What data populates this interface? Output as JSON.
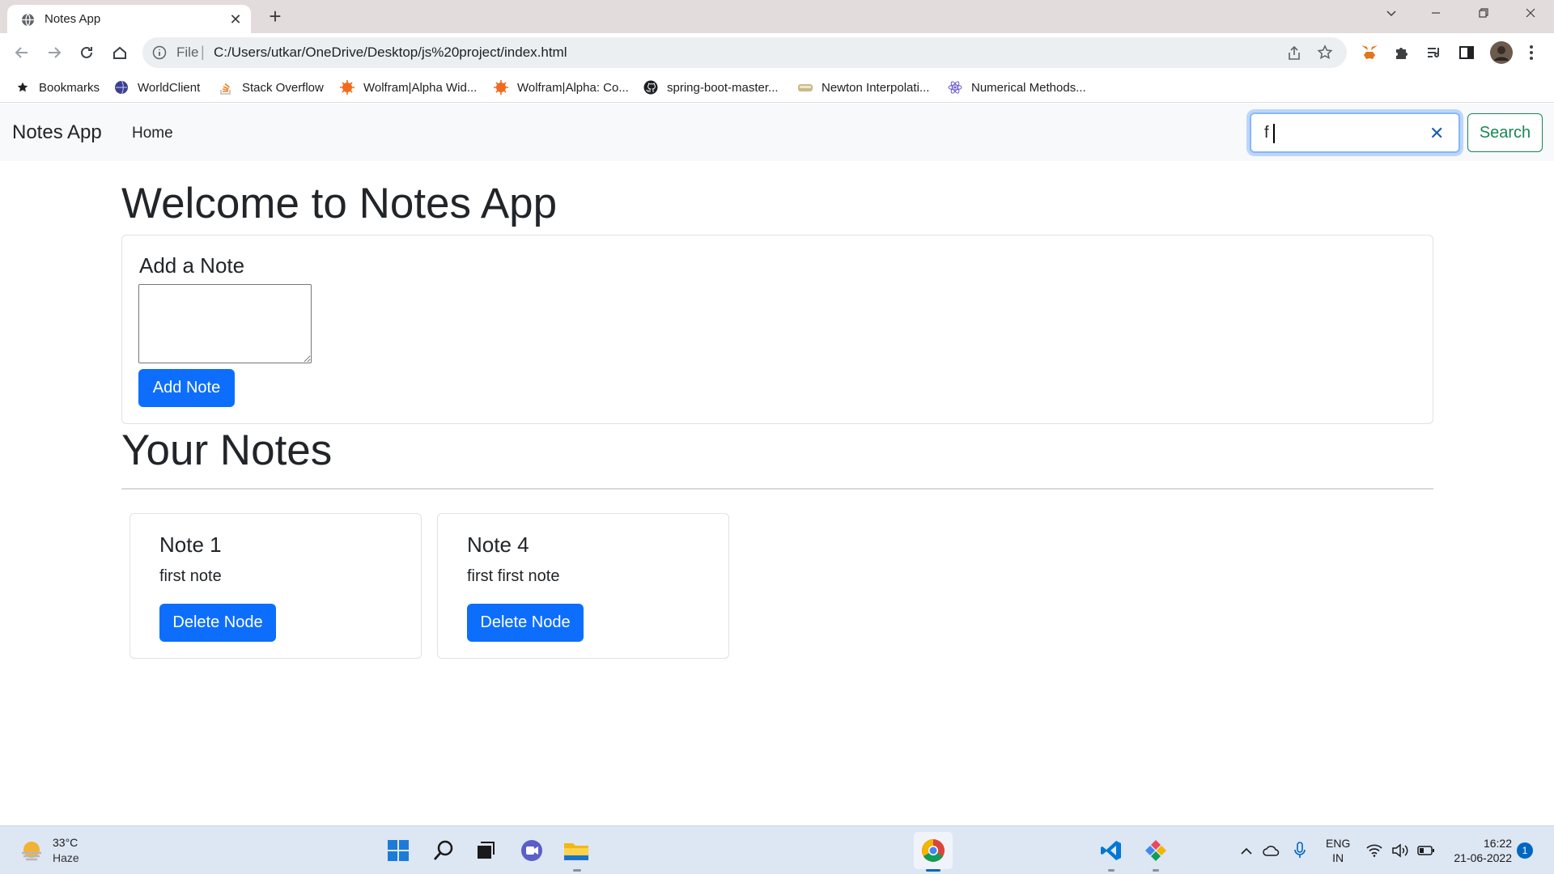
{
  "browser": {
    "tab_title": "Notes App",
    "tab_close": "✕",
    "new_tab": "+",
    "scheme": "File",
    "url": "C:/Users/utkar/OneDrive/Desktop/js%20project/index.html",
    "bookmarks": [
      {
        "label": "Bookmarks",
        "icon": "star-icon"
      },
      {
        "label": "WorldClient",
        "icon": "globe-icon"
      },
      {
        "label": "Stack Overflow",
        "icon": "stackoverflow-icon"
      },
      {
        "label": "Wolfram|Alpha Wid...",
        "icon": "wolfram-icon"
      },
      {
        "label": "Wolfram|Alpha: Co...",
        "icon": "wolfram-icon"
      },
      {
        "label": "spring-boot-master...",
        "icon": "github-icon"
      },
      {
        "label": "Newton Interpolati...",
        "icon": "page-icon"
      },
      {
        "label": "Numerical Methods...",
        "icon": "atom-icon"
      }
    ]
  },
  "page": {
    "brand": "Notes App",
    "nav_home": "Home",
    "search_value": "f",
    "search_button": "Search",
    "welcome_heading": "Welcome to Notes App",
    "add_note_title": "Add a Note",
    "add_note_button": "Add Note",
    "your_notes_heading": "Your Notes",
    "notes": [
      {
        "title": "Note 1",
        "text": "first note",
        "button": "Delete Node"
      },
      {
        "title": "Note 4",
        "text": "first first note",
        "button": "Delete Node"
      }
    ]
  },
  "taskbar": {
    "temperature": "33°C",
    "weather": "Haze",
    "lang_line1": "ENG",
    "lang_line2": "IN",
    "time": "16:22",
    "date": "21-06-2022",
    "notifications": "1"
  },
  "colors": {
    "primary": "#0d6efd",
    "success": "#198754",
    "navbar_bg": "#f8f9fa"
  }
}
